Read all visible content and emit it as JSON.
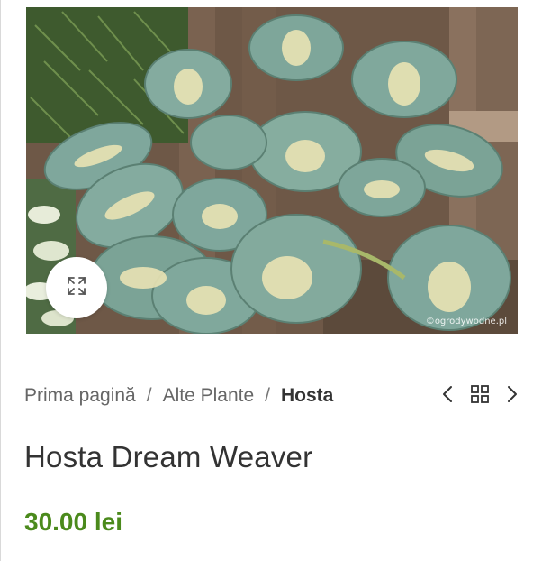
{
  "product": {
    "image": {
      "alt": "Hosta Dream Weaver",
      "watermark": "©ogrodywodne.pl"
    },
    "zoom_icon": "expand-arrows-icon",
    "title": "Hosta Dream Weaver",
    "price": "30.00 lei"
  },
  "breadcrumb": {
    "items": [
      {
        "label": "Prima pagină",
        "link": true
      },
      {
        "label": "Alte Plante",
        "link": true
      },
      {
        "label": "Hosta",
        "link": false
      }
    ],
    "separator": "/"
  },
  "product_nav": {
    "prev_icon": "chevron-left-icon",
    "grid_icon": "grid-icon",
    "next_icon": "chevron-right-icon"
  },
  "colors": {
    "price": "#4b8a1c",
    "title": "#333333",
    "breadcrumb": "#666666"
  }
}
